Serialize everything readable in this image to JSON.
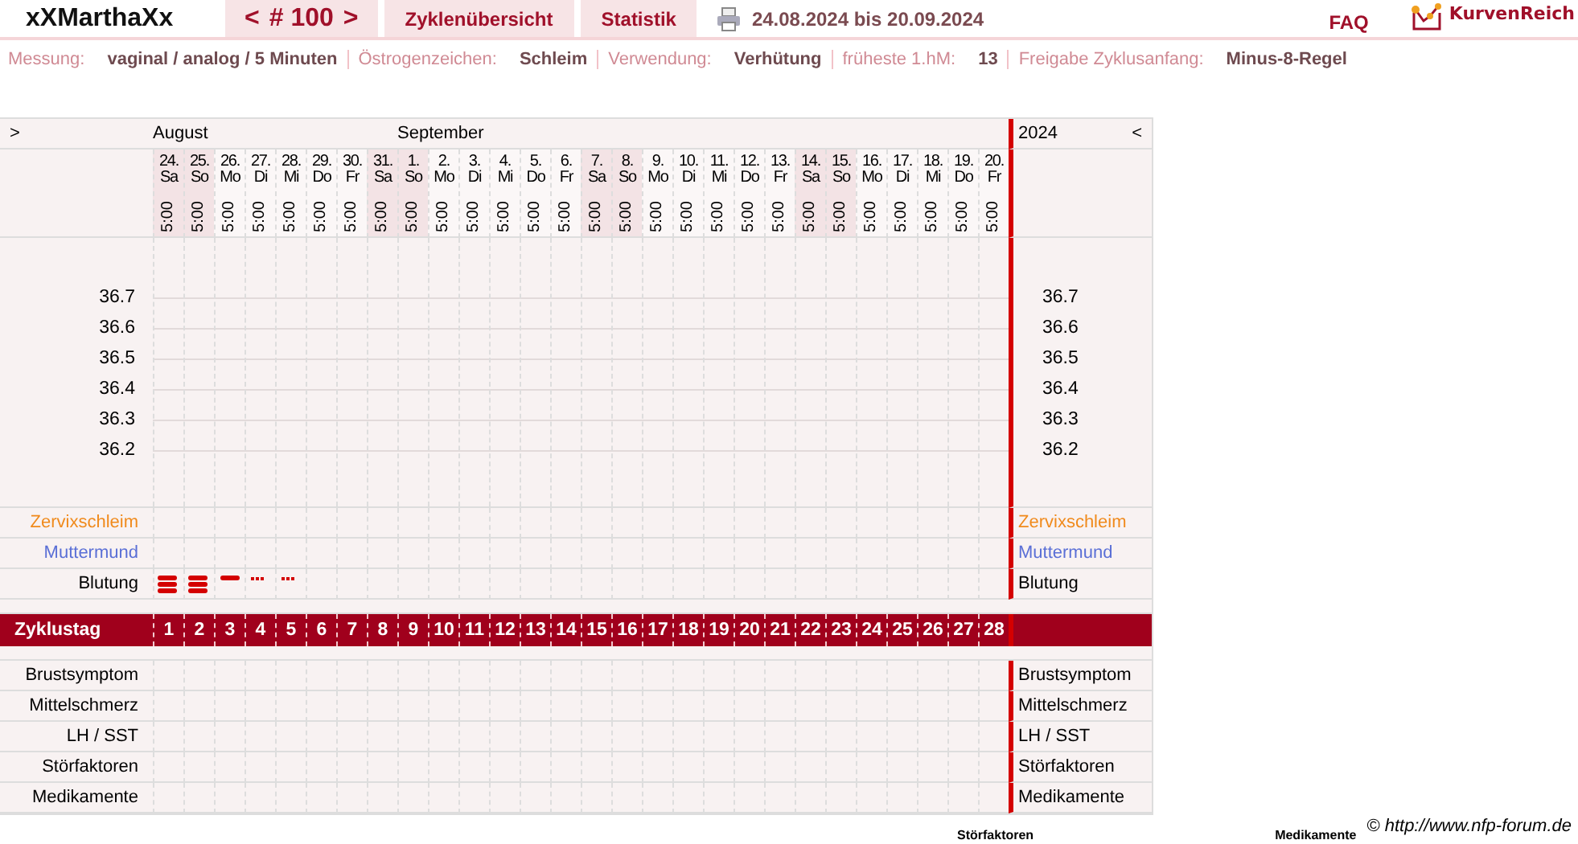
{
  "header": {
    "user": "xXMarthaXx",
    "cycle_prev": "<",
    "cycle": "# 100",
    "cycle_next": ">",
    "tabs": [
      {
        "label": "Zyklenübersicht"
      },
      {
        "label": "Statistik"
      }
    ],
    "date_range": "24.08.2024 bis 20.09.2024",
    "faq": "FAQ",
    "logo": "KurvenReich"
  },
  "info": [
    {
      "label": "Messung:",
      "value": "vaginal / analog / 5 Minuten"
    },
    {
      "label": "Östrogenzeichen:",
      "value": "Schleim"
    },
    {
      "label": "Verwendung:",
      "value": "Verhütung"
    },
    {
      "label": "früheste 1.hM:",
      "value": "13"
    },
    {
      "label": "Freigabe Zyklusanfang:",
      "value": "Minus-8-Regel"
    }
  ],
  "chart": {
    "left_nav": ">",
    "year": "2024",
    "right_nav": "<",
    "left_scale": [
      "36.7",
      "36.6",
      "36.5",
      "36.4",
      "36.3",
      "36.2"
    ],
    "right_scale": [
      "36.7",
      "36.6",
      "36.5",
      "36.4",
      "36.3",
      "36.2"
    ],
    "days": [
      {
        "month": "August",
        "date": "24.",
        "weekday": "Sa",
        "time": "5:00",
        "weekend": true,
        "cycle_day": "1"
      },
      {
        "date": "25.",
        "weekday": "So",
        "time": "5:00",
        "weekend": true,
        "cycle_day": "2"
      },
      {
        "date": "26.",
        "weekday": "Mo",
        "time": "5:00",
        "weekend": false,
        "cycle_day": "3"
      },
      {
        "date": "27.",
        "weekday": "Di",
        "time": "5:00",
        "weekend": false,
        "cycle_day": "4"
      },
      {
        "date": "28.",
        "weekday": "Mi",
        "time": "5:00",
        "weekend": false,
        "cycle_day": "5"
      },
      {
        "date": "29.",
        "weekday": "Do",
        "time": "5:00",
        "weekend": false,
        "cycle_day": "6"
      },
      {
        "date": "30.",
        "weekday": "Fr",
        "time": "5:00",
        "weekend": false,
        "cycle_day": "7"
      },
      {
        "date": "31.",
        "weekday": "Sa",
        "time": "5:00",
        "weekend": true,
        "cycle_day": "8"
      },
      {
        "month": "September",
        "date": "1.",
        "weekday": "So",
        "time": "5:00",
        "weekend": true,
        "cycle_day": "9"
      },
      {
        "date": "2.",
        "weekday": "Mo",
        "time": "5:00",
        "weekend": false,
        "cycle_day": "10"
      },
      {
        "date": "3.",
        "weekday": "Di",
        "time": "5:00",
        "weekend": false,
        "cycle_day": "11"
      },
      {
        "date": "4.",
        "weekday": "Mi",
        "time": "5:00",
        "weekend": false,
        "cycle_day": "12"
      },
      {
        "date": "5.",
        "weekday": "Do",
        "time": "5:00",
        "weekend": false,
        "cycle_day": "13"
      },
      {
        "date": "6.",
        "weekday": "Fr",
        "time": "5:00",
        "weekend": false,
        "cycle_day": "14"
      },
      {
        "date": "7.",
        "weekday": "Sa",
        "time": "5:00",
        "weekend": true,
        "cycle_day": "15"
      },
      {
        "date": "8.",
        "weekday": "So",
        "time": "5:00",
        "weekend": true,
        "cycle_day": "16"
      },
      {
        "date": "9.",
        "weekday": "Mo",
        "time": "5:00",
        "weekend": false,
        "cycle_day": "17"
      },
      {
        "date": "10.",
        "weekday": "Di",
        "time": "5:00",
        "weekend": false,
        "cycle_day": "18"
      },
      {
        "date": "11.",
        "weekday": "Mi",
        "time": "5:00",
        "weekend": false,
        "cycle_day": "19"
      },
      {
        "date": "12.",
        "weekday": "Do",
        "time": "5:00",
        "weekend": false,
        "cycle_day": "20"
      },
      {
        "date": "13.",
        "weekday": "Fr",
        "time": "5:00",
        "weekend": false,
        "cycle_day": "21"
      },
      {
        "date": "14.",
        "weekday": "Sa",
        "time": "5:00",
        "weekend": true,
        "cycle_day": "22"
      },
      {
        "date": "15.",
        "weekday": "So",
        "time": "5:00",
        "weekend": true,
        "cycle_day": "23"
      },
      {
        "date": "16.",
        "weekday": "Mo",
        "time": "5:00",
        "weekend": false,
        "cycle_day": "24"
      },
      {
        "date": "17.",
        "weekday": "Di",
        "time": "5:00",
        "weekend": false,
        "cycle_day": "25"
      },
      {
        "date": "18.",
        "weekday": "Mi",
        "time": "5:00",
        "weekend": false,
        "cycle_day": "26"
      },
      {
        "date": "19.",
        "weekday": "Do",
        "time": "5:00",
        "weekend": false,
        "cycle_day": "27"
      },
      {
        "date": "20.",
        "weekday": "Fr",
        "time": "5:00",
        "weekend": false,
        "cycle_day": "28"
      }
    ],
    "upper_rows": [
      {
        "kind": "plain",
        "label": "Zervixschleim",
        "right_label": "Zervixschleim",
        "color": "#f08a1c"
      },
      {
        "kind": "plain",
        "label": "Muttermund",
        "right_label": "Muttermund",
        "color": "#5a6fd6"
      },
      {
        "kind": "bleeding",
        "label": "Blutung",
        "right_label": "Blutung",
        "color": "#000000",
        "marks": [
          {
            "kind": "heavy"
          },
          {
            "kind": "heavy"
          },
          {
            "kind": "normal"
          },
          {
            "kind": "spotting"
          },
          {
            "kind": "spotting"
          }
        ]
      }
    ],
    "cycle_day_label": "Zyklustag",
    "lower_rows": [
      {
        "label": "Brustsymptom",
        "right_label": "Brustsymptom"
      },
      {
        "label": "Mittelschmerz",
        "right_label": "Mittelschmerz"
      },
      {
        "label": "LH / SST",
        "right_label": "LH / SST"
      },
      {
        "label": "Störfaktoren",
        "right_label": "Störfaktoren"
      },
      {
        "label": "Medikamente",
        "right_label": "Medikamente"
      }
    ]
  },
  "copyright": "© http://www.nfp-forum.de",
  "footer_headings": [
    "Störfaktoren",
    "Medikamente"
  ]
}
